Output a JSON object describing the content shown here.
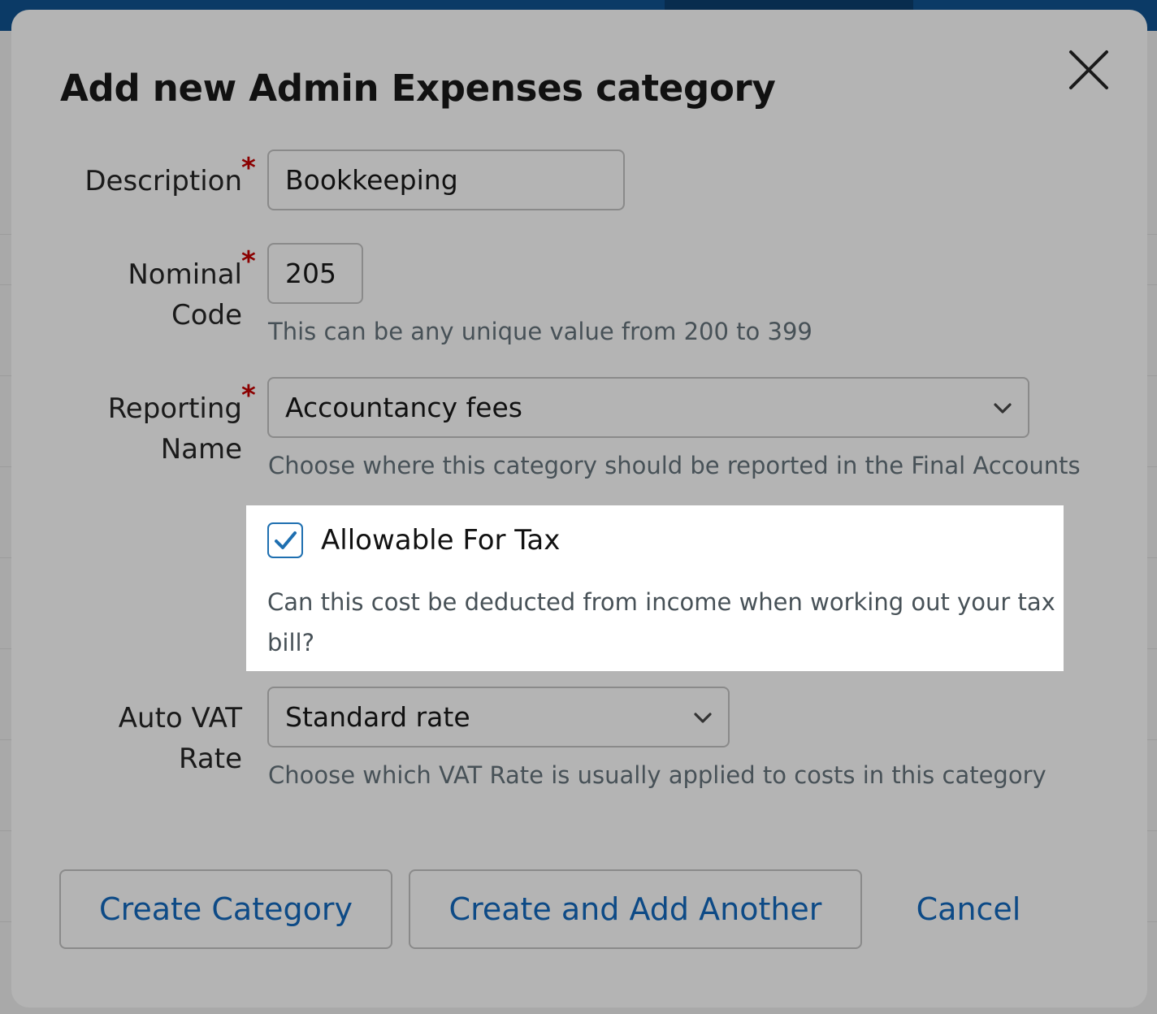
{
  "modal": {
    "title": "Add new Admin Expenses category",
    "close_icon": "close-icon"
  },
  "form": {
    "description": {
      "label": "Description",
      "required_mark": "*",
      "value": "Bookkeeping"
    },
    "nominal_code": {
      "label_line1": "Nominal",
      "label_line2": "Code",
      "required_mark": "*",
      "value": "205",
      "help": "This can be any unique value from 200 to 399"
    },
    "reporting_name": {
      "label_line1": "Reporting",
      "label_line2": "Name",
      "required_mark": "*",
      "selected": "Accountancy fees",
      "help": "Choose where this category should be reported in the Final Accounts"
    },
    "allowable_for_tax": {
      "checked": true,
      "label": "Allowable For Tax",
      "help": "Can this cost be deducted from income when working out your tax bill?"
    },
    "auto_vat_rate": {
      "label_line1": "Auto VAT",
      "label_line2": "Rate",
      "selected": "Standard rate",
      "help": "Choose which VAT Rate is usually applied to costs in this category"
    }
  },
  "actions": {
    "create_label": "Create Category",
    "create_another_label": "Create and Add Another",
    "cancel_label": "Cancel"
  },
  "colors": {
    "link_blue": "#0d4a86",
    "required_red": "#8b0000",
    "checkbox_blue": "#1e6fb0"
  }
}
